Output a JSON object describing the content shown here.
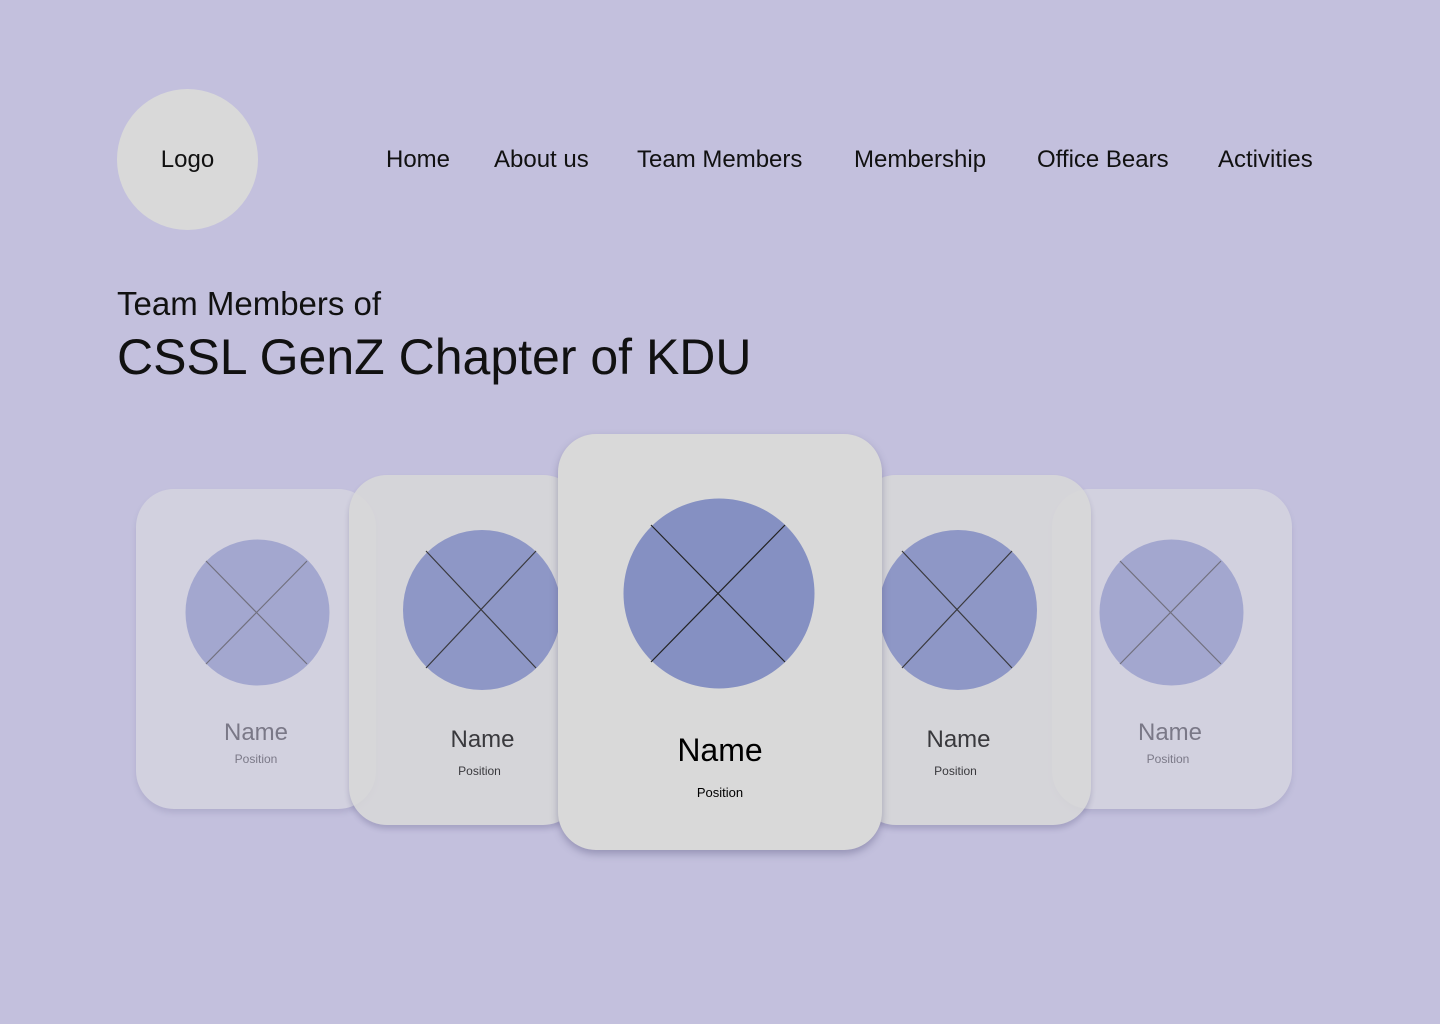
{
  "header": {
    "logo_label": "Logo",
    "nav": [
      {
        "label": "Home"
      },
      {
        "label": "About us"
      },
      {
        "label": "Team Members"
      },
      {
        "label": "Membership"
      },
      {
        "label": "Office Bears"
      },
      {
        "label": "Activities"
      }
    ]
  },
  "hero": {
    "subtitle": "Team Members of",
    "title": "CSSL GenZ Chapter of KDU"
  },
  "cards": [
    {
      "name": "Name",
      "position": "Position"
    },
    {
      "name": "Name",
      "position": "Position"
    },
    {
      "name": "Name",
      "position": "Position"
    },
    {
      "name": "Name",
      "position": "Position"
    },
    {
      "name": "Name",
      "position": "Position"
    }
  ],
  "colors": {
    "background": "#c3c0dd",
    "card": "#d9d9d9",
    "photo_placeholder": "#8590c2",
    "logo": "#d9d9d9"
  }
}
